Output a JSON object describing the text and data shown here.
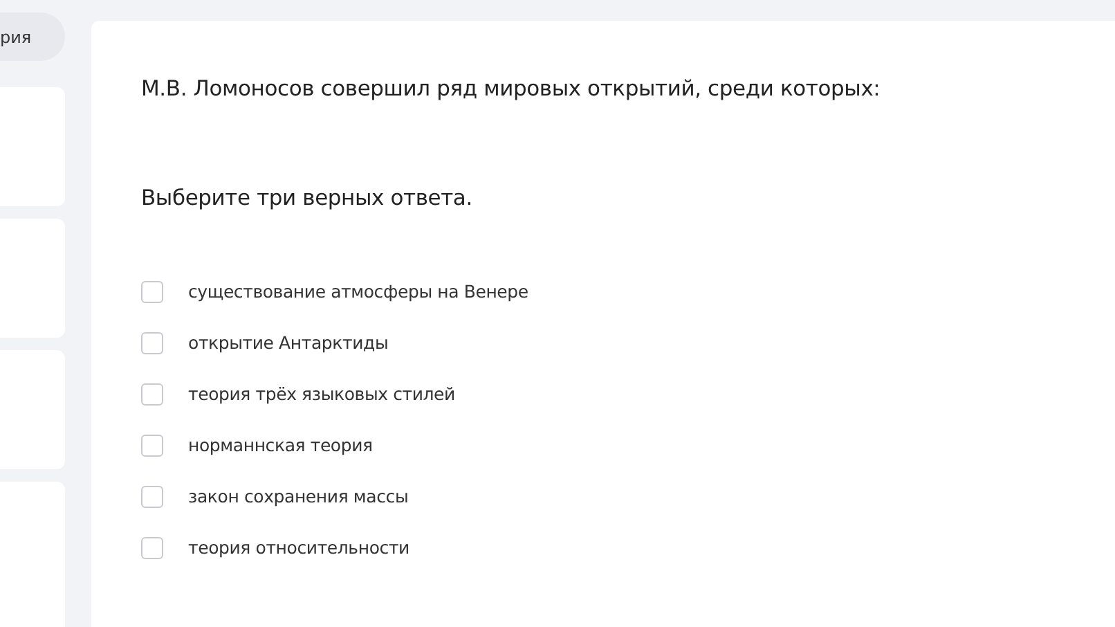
{
  "sidebar": {
    "pill_label": "рия"
  },
  "question": {
    "text": "М.В. Ломоносов совершил ряд мировых открытий, среди которых:",
    "instruction": "Выберите три верных ответа.",
    "options": [
      {
        "label": "существование атмосферы на Венере",
        "checked": false
      },
      {
        "label": "открытие Антарктиды",
        "checked": false
      },
      {
        "label": "теория трёх языковых стилей",
        "checked": false
      },
      {
        "label": "норманнская теория",
        "checked": false
      },
      {
        "label": "закон сохранения массы",
        "checked": false
      },
      {
        "label": "теория относительности",
        "checked": false
      }
    ]
  }
}
